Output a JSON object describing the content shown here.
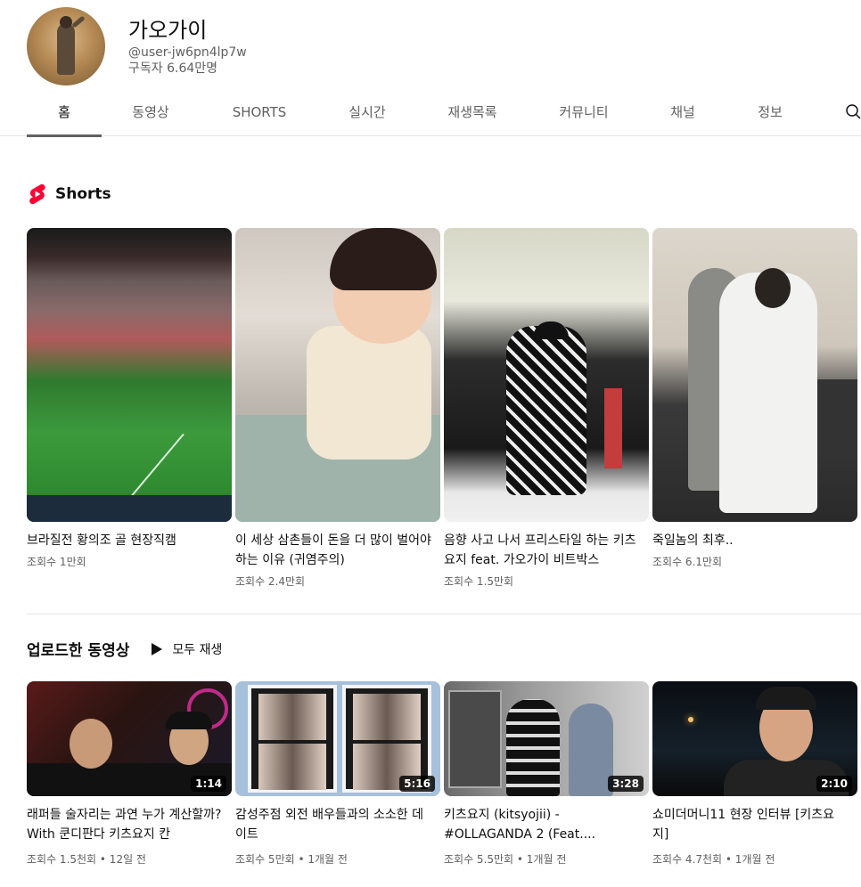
{
  "channel": {
    "name": "가오가이",
    "handle": "@user-jw6pn4lp7w",
    "subscribers": "구독자 6.64만명"
  },
  "tabs": [
    {
      "label": "홈",
      "active": true
    },
    {
      "label": "동영상",
      "active": false
    },
    {
      "label": "SHORTS",
      "active": false
    },
    {
      "label": "실시간",
      "active": false
    },
    {
      "label": "재생목록",
      "active": false
    },
    {
      "label": "커뮤니티",
      "active": false
    },
    {
      "label": "채널",
      "active": false
    },
    {
      "label": "정보",
      "active": false
    }
  ],
  "shorts": {
    "title": "Shorts",
    "items": [
      {
        "title": "브라질전 황의조 골 현장직캠",
        "views": "조회수 1만회"
      },
      {
        "title": "이 세상 삼촌들이 돈을 더 많이 벌어야하는 이유 (귀염주의)",
        "views": "조회수 2.4만회"
      },
      {
        "title": "음향 사고 나서 프리스타일 하는 키츠요지 feat. 가오가이 비트박스",
        "views": "조회수 1.5만회"
      },
      {
        "title": "죽일놈의 최후..",
        "views": "조회수 6.1만회"
      }
    ]
  },
  "uploads": {
    "title": "업로드한 동영상",
    "play_all": "모두 재생",
    "items": [
      {
        "title": "래퍼들 술자리는 과연 누가 계산할까? With 쿤디판다 키츠요지 칸",
        "duration": "1:14",
        "meta": "조회수 1.5천회 • 12일 전"
      },
      {
        "title": "감성주점 외전 배우들과의 소소한 데이트",
        "duration": "5:16",
        "meta": "조회수 5만회 • 1개월 전"
      },
      {
        "title": "키츠요지 (kitsyojii) - #OLLAGANDA 2 (Feat....",
        "duration": "3:28",
        "meta": "조회수 5.5만회 • 1개월 전"
      },
      {
        "title": "쇼미더머니11 현장 인터뷰 [키츠요지]",
        "duration": "2:10",
        "meta": "조회수 4.7천회 • 1개월 전"
      }
    ]
  },
  "colors": {
    "shorts_red": "#ff0033",
    "text_primary": "#0f0f0f",
    "text_secondary": "#606060",
    "divider": "#e5e5e5"
  },
  "icons": {
    "shorts": "shorts-logo-icon",
    "play_all": "play-icon",
    "search": "search-icon"
  }
}
